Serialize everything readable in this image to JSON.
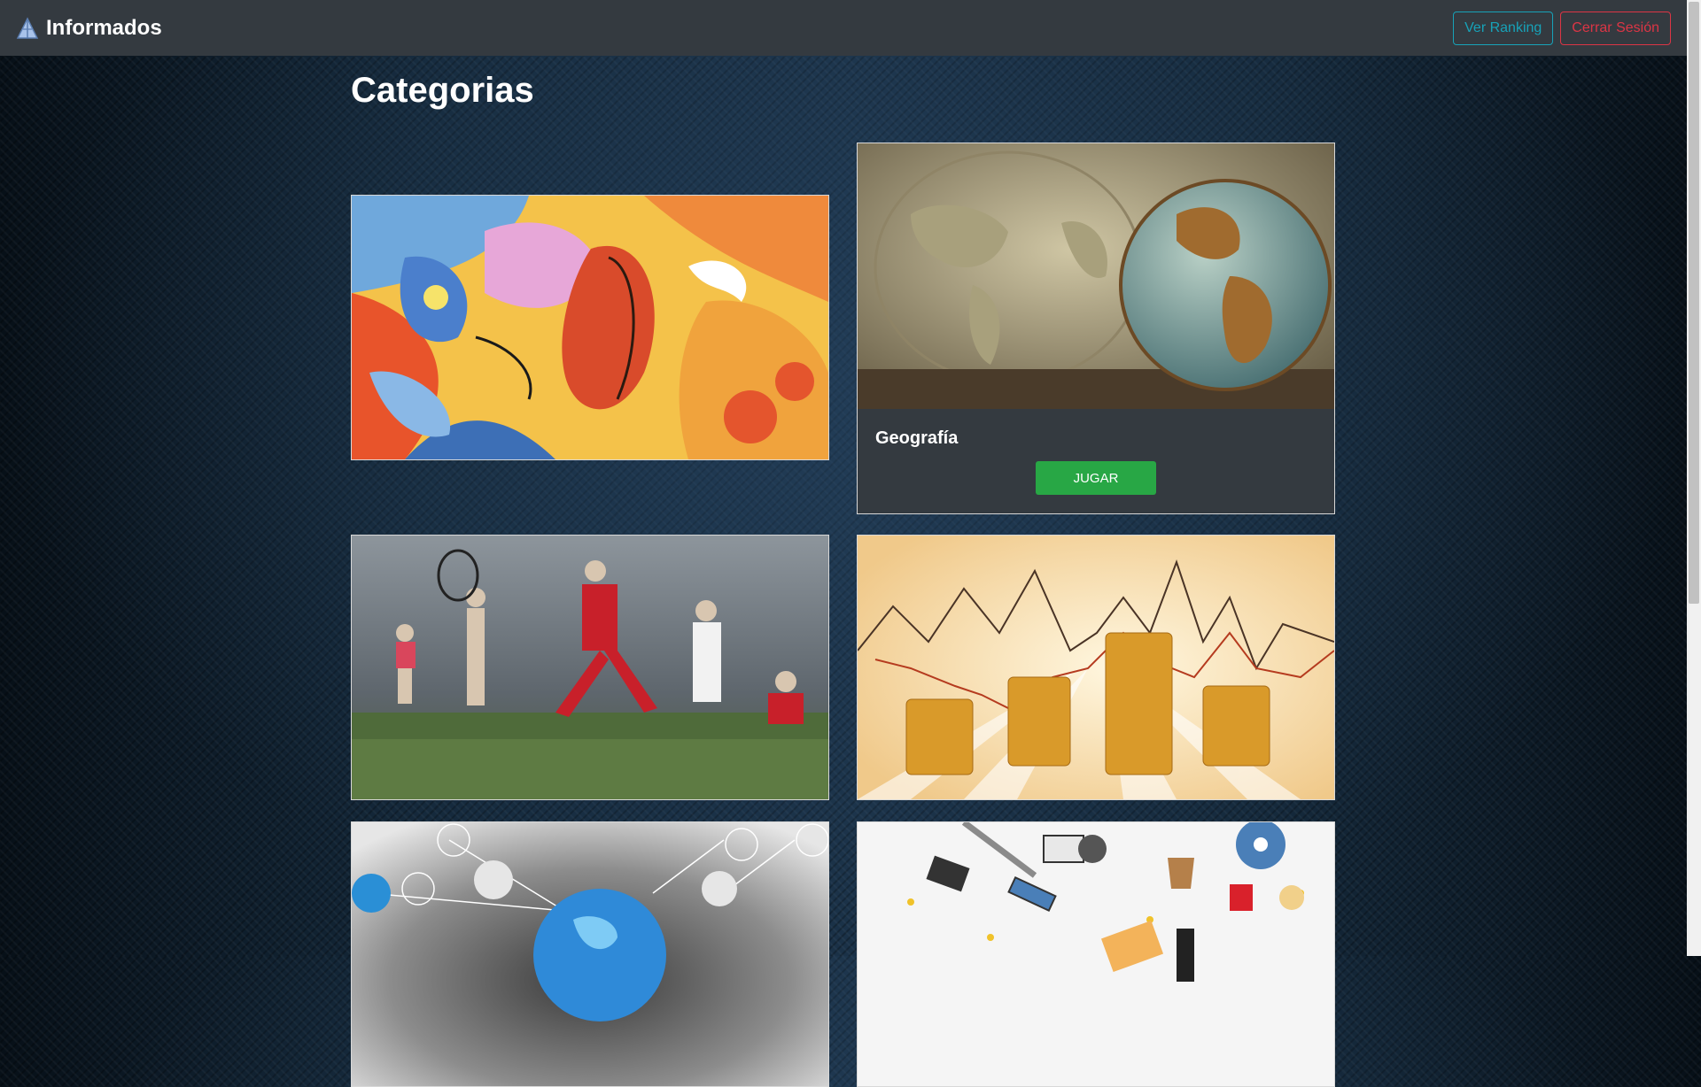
{
  "navbar": {
    "brand": "Informados",
    "brand_icon": "flask-icon",
    "ranking_label": "Ver Ranking",
    "logout_label": "Cerrar Sesión"
  },
  "page": {
    "title": "Categorias"
  },
  "categories": [
    {
      "image": "music-painting"
    },
    {
      "image": "world-map-globe",
      "title": "Geografía",
      "button_label": "JUGAR"
    },
    {
      "image": "sports-athletes"
    },
    {
      "image": "finance-coins-chart"
    },
    {
      "image": "technology-globe-network"
    },
    {
      "image": "cinema-items"
    }
  ],
  "colors": {
    "navbar": "#343a40",
    "info": "#17a2b8",
    "danger": "#dc3545",
    "success": "#28a745"
  }
}
